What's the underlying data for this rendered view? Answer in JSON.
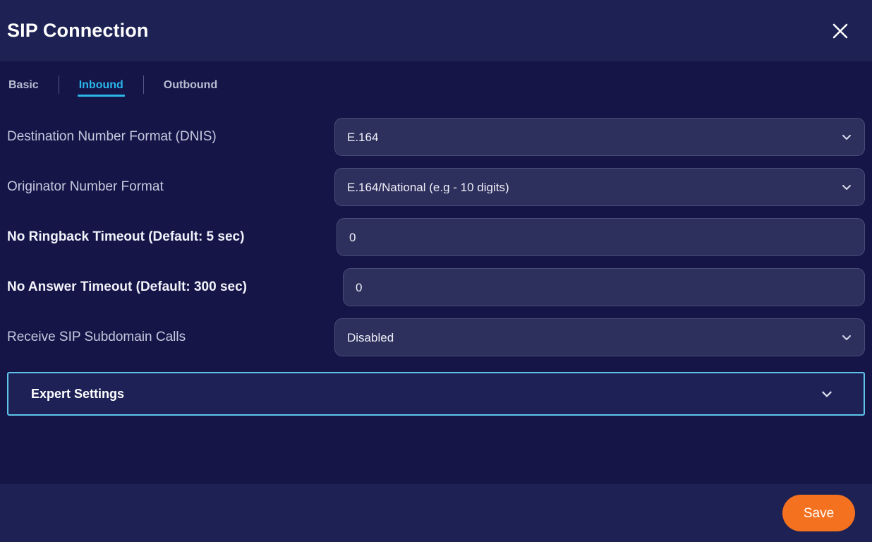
{
  "header": {
    "title": "SIP Connection",
    "close_icon": "close-icon"
  },
  "tabs": [
    {
      "label": "Basic",
      "active": false
    },
    {
      "label": "Inbound",
      "active": true
    },
    {
      "label": "Outbound",
      "active": false
    }
  ],
  "form": {
    "fields": [
      {
        "label": "Destination Number Format (DNIS)",
        "type": "select",
        "value": "E.164",
        "emphasis": false,
        "icon": "chevron-down-icon"
      },
      {
        "label": "Originator Number Format",
        "type": "select",
        "value": "E.164/National (e.g - 10 digits)",
        "emphasis": false,
        "icon": "chevron-down-icon"
      },
      {
        "label": "No Ringback Timeout (Default: 5 sec)",
        "type": "input",
        "value": "0",
        "emphasis": true,
        "icon": ""
      },
      {
        "label": "No Answer Timeout (Default: 300 sec)",
        "type": "input",
        "value": "0",
        "emphasis": true,
        "icon": ""
      },
      {
        "label": "Receive SIP Subdomain Calls",
        "type": "select",
        "value": "Disabled",
        "emphasis": false,
        "icon": "chevron-down-icon"
      }
    ]
  },
  "expert_settings": {
    "label": "Expert Settings",
    "expanded": false,
    "icon": "chevron-down-icon"
  },
  "footer": {
    "save_label": "Save"
  },
  "colors": {
    "header_bg": "#1d2153",
    "body_bg": "#151548",
    "field_bg": "#2d2f5c",
    "field_border": "#4a4c78",
    "accent_cyan": "#2ab7ea",
    "expert_border": "#5ec4ea",
    "save_orange": "#f4711f",
    "label_muted": "#c6cade",
    "label_strong": "#f2f3fa"
  }
}
